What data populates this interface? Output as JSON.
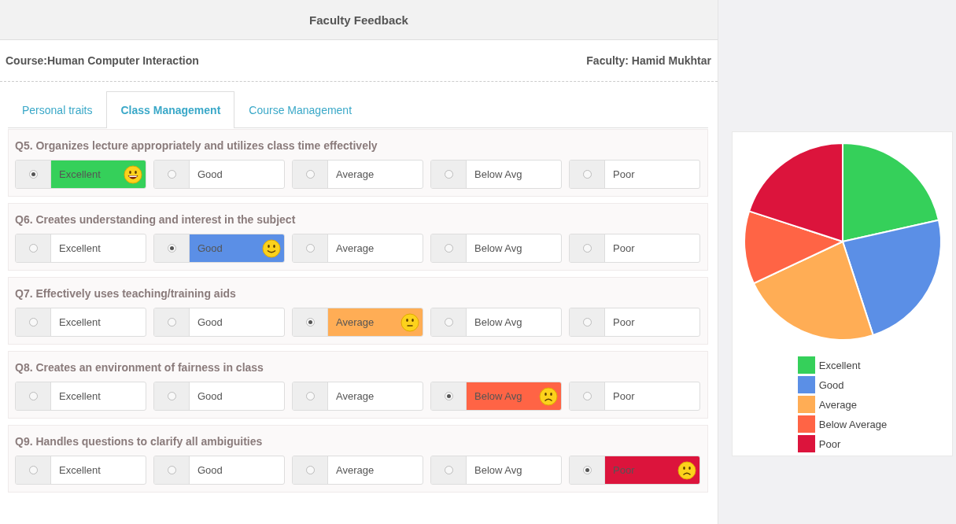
{
  "header": {
    "title": "Faculty Feedback"
  },
  "course": "Course:Human Computer Interaction",
  "faculty": "Faculty: Hamid Mukhtar",
  "tabs": [
    {
      "label": "Personal traits",
      "selected": false
    },
    {
      "label": "Class Management",
      "selected": true
    },
    {
      "label": "Course Management",
      "selected": false
    }
  ],
  "questions": [
    {
      "text": "Q5. Organizes lecture appropriately and utilizes class time effectively",
      "color": "#35d05a",
      "kind": "grin",
      "options": [
        {
          "label": "Excellent",
          "selected": true
        },
        {
          "label": "Good",
          "selected": false
        },
        {
          "label": "Average",
          "selected": false
        },
        {
          "label": "Below Avg",
          "selected": false
        },
        {
          "label": "Poor",
          "selected": false
        }
      ]
    },
    {
      "text": "Q6. Creates understanding and interest in the subject",
      "color": "#5b8fe6",
      "kind": "smile",
      "options": [
        {
          "label": "Excellent",
          "selected": false
        },
        {
          "label": "Good",
          "selected": true
        },
        {
          "label": "Average",
          "selected": false
        },
        {
          "label": "Below Avg",
          "selected": false
        },
        {
          "label": "Poor",
          "selected": false
        }
      ]
    },
    {
      "text": "Q7. Effectively uses teaching/training aids",
      "color": "#ffad55",
      "kind": "neutral",
      "options": [
        {
          "label": "Excellent",
          "selected": false
        },
        {
          "label": "Good",
          "selected": false
        },
        {
          "label": "Average",
          "selected": true
        },
        {
          "label": "Below Avg",
          "selected": false
        },
        {
          "label": "Poor",
          "selected": false
        }
      ]
    },
    {
      "text": "Q8. Creates an environment of fairness in class",
      "color": "#ff6445",
      "kind": "frown",
      "options": [
        {
          "label": "Excellent",
          "selected": false
        },
        {
          "label": "Good",
          "selected": false
        },
        {
          "label": "Average",
          "selected": false
        },
        {
          "label": "Below Avg",
          "selected": true
        },
        {
          "label": "Poor",
          "selected": false
        }
      ]
    },
    {
      "text": "Q9. Handles questions to clarify all ambiguities",
      "color": "#dc143c",
      "kind": "frown",
      "options": [
        {
          "label": "Excellent",
          "selected": false
        },
        {
          "label": "Good",
          "selected": false
        },
        {
          "label": "Average",
          "selected": false
        },
        {
          "label": "Below Avg",
          "selected": false
        },
        {
          "label": "Poor",
          "selected": true
        }
      ]
    }
  ],
  "legend": [
    {
      "label": "Excellent",
      "color": "#35d05a"
    },
    {
      "label": "Good",
      "color": "#5b8fe6"
    },
    {
      "label": "Average",
      "color": "#ffad55"
    },
    {
      "label": "Below Average",
      "color": "#ff6445"
    },
    {
      "label": "Poor",
      "color": "#dc143c"
    }
  ]
}
